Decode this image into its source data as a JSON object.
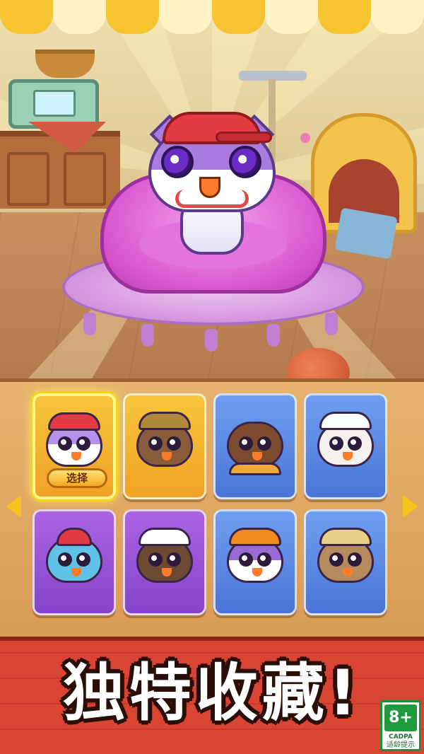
{
  "collection": {
    "select_label": "选择",
    "cards": [
      {
        "id": "purple-cap-cat",
        "style": "gold",
        "selected": true
      },
      {
        "id": "dragon-hood-cat",
        "style": "gold",
        "selected": false
      },
      {
        "id": "scarf-owl-cat",
        "style": "blue",
        "selected": false
      },
      {
        "id": "sailor-cat",
        "style": "blue",
        "selected": false
      },
      {
        "id": "red-bow-blue-cat",
        "style": "purple",
        "selected": false
      },
      {
        "id": "chef-cat",
        "style": "purple",
        "selected": false
      },
      {
        "id": "pumpkin-cat",
        "style": "blue",
        "selected": false
      },
      {
        "id": "straw-hat-cat",
        "style": "blue",
        "selected": false
      }
    ],
    "nav": {
      "left_icon": "arrow-left-icon",
      "right_icon": "arrow-right-icon"
    }
  },
  "banner": {
    "headline": "独特收藏!"
  },
  "rating": {
    "age": "8+",
    "org": "CADPA",
    "tip": "适龄提示"
  },
  "colors": {
    "card_gold": "#f7c53b",
    "card_blue": "#6f9ff0",
    "card_purple": "#a864e2",
    "banner_red": "#d94433",
    "rating_green": "#1f9a3e"
  }
}
